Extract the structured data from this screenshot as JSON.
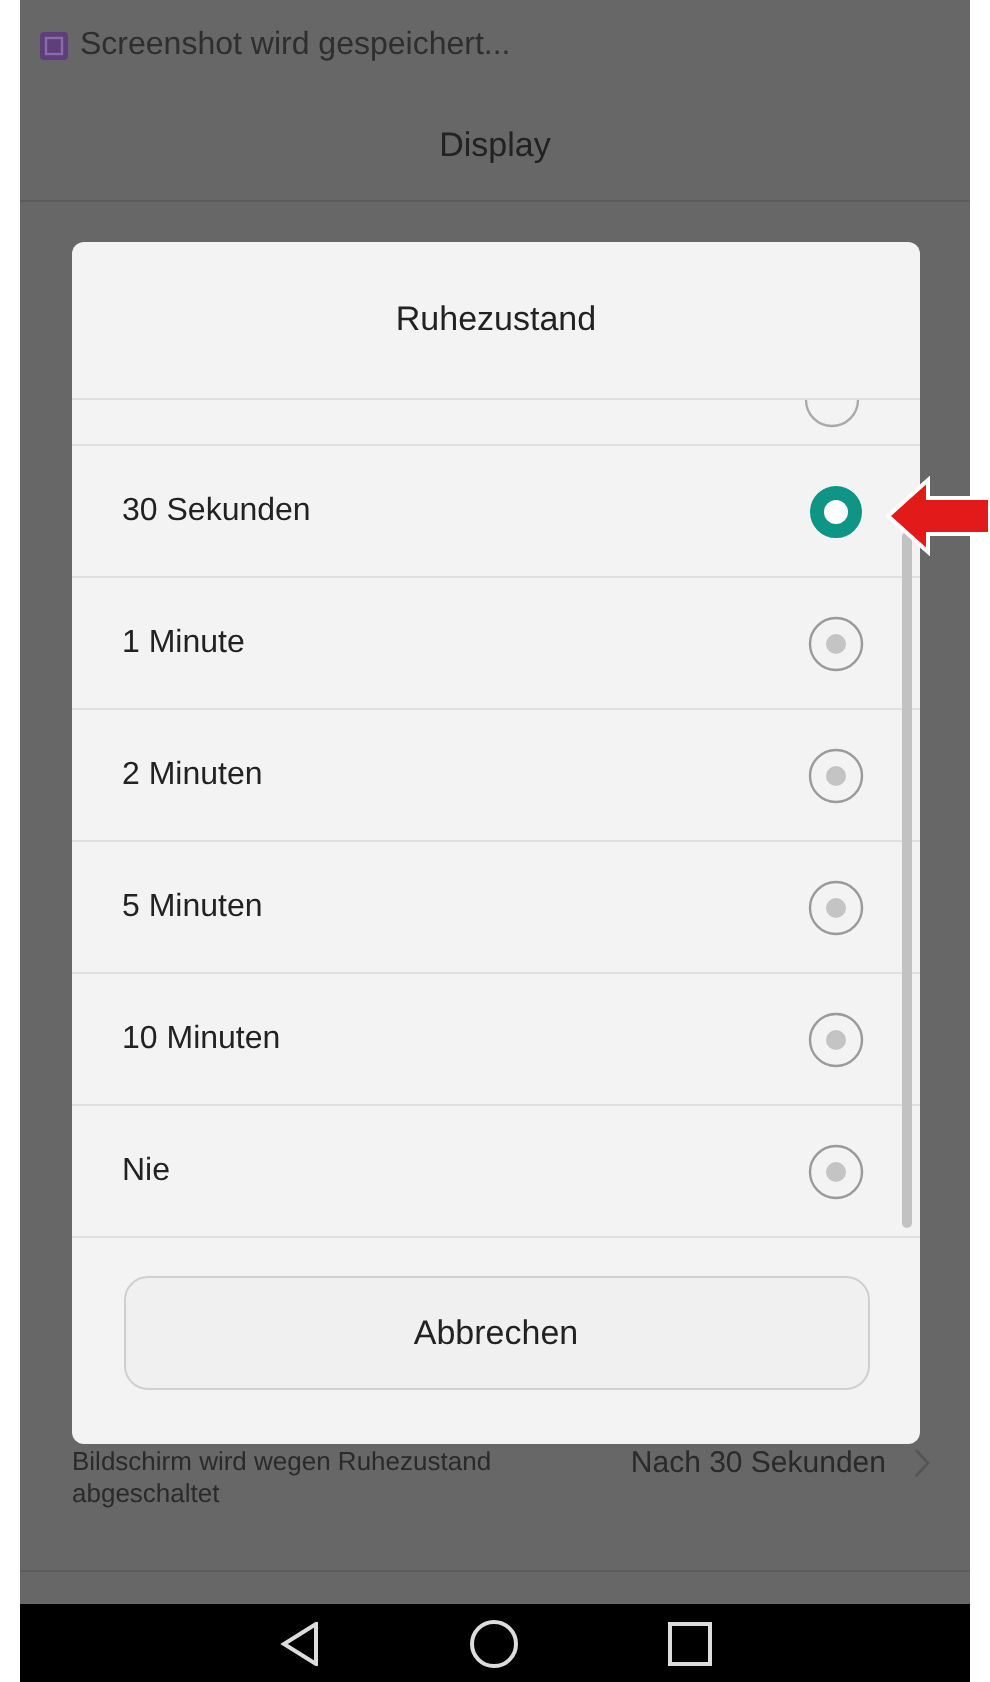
{
  "status_bar": {
    "notification": "Screenshot wird gespeichert..."
  },
  "header": {
    "title": "Display"
  },
  "background_setting": {
    "label": "Bildschirm wird wegen Ruhezustand abgeschaltet",
    "value": "Nach 30 Sekunden"
  },
  "dialog": {
    "title": "Ruhezustand",
    "options": [
      {
        "label": "30 Sekunden",
        "selected": true
      },
      {
        "label": "1 Minute",
        "selected": false
      },
      {
        "label": "2 Minuten",
        "selected": false
      },
      {
        "label": "5 Minuten",
        "selected": false
      },
      {
        "label": "10 Minuten",
        "selected": false
      },
      {
        "label": "Nie",
        "selected": false
      }
    ],
    "cancel_button": "Abbrechen"
  }
}
